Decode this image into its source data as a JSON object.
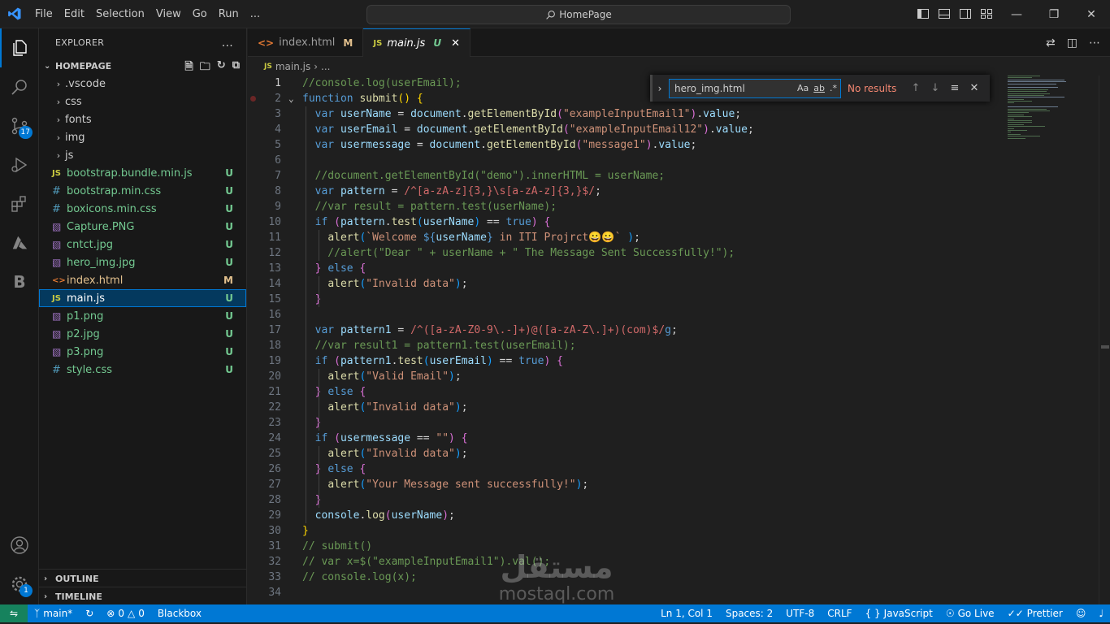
{
  "menu": [
    "File",
    "Edit",
    "Selection",
    "View",
    "Go",
    "Run",
    "..."
  ],
  "command_center": "HomePage",
  "explorer": {
    "title": "EXPLORER",
    "more": "...",
    "folder": "HOMEPAGE",
    "items": [
      {
        "label": ".vscode",
        "type": "folder",
        "status": ""
      },
      {
        "label": "css",
        "type": "folder",
        "status": ""
      },
      {
        "label": "fonts",
        "type": "folder",
        "status": ""
      },
      {
        "label": "img",
        "type": "folder",
        "status": ""
      },
      {
        "label": "js",
        "type": "folder",
        "status": ""
      },
      {
        "label": "bootstrap.bundle.min.js",
        "type": "js",
        "status": "U"
      },
      {
        "label": "bootstrap.min.css",
        "type": "css",
        "status": "U"
      },
      {
        "label": "boxicons.min.css",
        "type": "css",
        "status": "U"
      },
      {
        "label": "Capture.PNG",
        "type": "image",
        "status": "U"
      },
      {
        "label": "cntct.jpg",
        "type": "image",
        "status": "U"
      },
      {
        "label": "hero_img.jpg",
        "type": "image",
        "status": "U"
      },
      {
        "label": "index.html",
        "type": "html",
        "status": "M"
      },
      {
        "label": "main.js",
        "type": "js",
        "status": "U",
        "selected": true
      },
      {
        "label": "p1.png",
        "type": "image",
        "status": "U"
      },
      {
        "label": "p2.jpg",
        "type": "image",
        "status": "U"
      },
      {
        "label": "p3.png",
        "type": "image",
        "status": "U"
      },
      {
        "label": "style.css",
        "type": "css",
        "status": "U"
      }
    ],
    "outline": "OUTLINE",
    "timeline": "TIMELINE"
  },
  "activity": {
    "source_control_badge": "17",
    "accounts_badge": "1"
  },
  "tabs": [
    {
      "label": "index.html",
      "status": "M",
      "icon": "html-file-icon"
    },
    {
      "label": "main.js",
      "status": "U",
      "icon": "js-file-icon",
      "active": true
    }
  ],
  "breadcrumb": {
    "file": "main.js",
    "rest": "..."
  },
  "find": {
    "query": "hero_img.html",
    "match_case": "Aa",
    "whole_word": "ab",
    "regex": ".*",
    "result": "No results"
  },
  "editor": {
    "lines": [
      {
        "n": "1",
        "t": [
          [
            "//console.log(userEmail);",
            "cm"
          ]
        ]
      },
      {
        "n": "2",
        "t": [
          [
            "function",
            "kw"
          ],
          [
            " ",
            "pl"
          ],
          [
            "submit",
            "fn"
          ],
          [
            "() ",
            "b1"
          ],
          [
            "{",
            "b1"
          ]
        ]
      },
      {
        "n": "3",
        "t": [
          [
            "  ",
            "pl"
          ],
          [
            "var",
            "kw"
          ],
          [
            " ",
            "pl"
          ],
          [
            "userName",
            "vr"
          ],
          [
            " = ",
            "op"
          ],
          [
            "document",
            "vr"
          ],
          [
            ".",
            "op"
          ],
          [
            "getElementById",
            "fn"
          ],
          [
            "(",
            "b2"
          ],
          [
            "\"exampleInputEmail1\"",
            "st"
          ],
          [
            ")",
            "b2"
          ],
          [
            ".",
            "op"
          ],
          [
            "value",
            "vr"
          ],
          [
            ";",
            "op"
          ]
        ]
      },
      {
        "n": "4",
        "t": [
          [
            "  ",
            "pl"
          ],
          [
            "var",
            "kw"
          ],
          [
            " ",
            "pl"
          ],
          [
            "userEmail",
            "vr"
          ],
          [
            " = ",
            "op"
          ],
          [
            "document",
            "vr"
          ],
          [
            ".",
            "op"
          ],
          [
            "getElementById",
            "fn"
          ],
          [
            "(",
            "b2"
          ],
          [
            "\"exampleInputEmail12\"",
            "st"
          ],
          [
            ")",
            "b2"
          ],
          [
            ".",
            "op"
          ],
          [
            "value",
            "vr"
          ],
          [
            ";",
            "op"
          ]
        ]
      },
      {
        "n": "5",
        "t": [
          [
            "  ",
            "pl"
          ],
          [
            "var",
            "kw"
          ],
          [
            " ",
            "pl"
          ],
          [
            "usermessage",
            "vr"
          ],
          [
            " = ",
            "op"
          ],
          [
            "document",
            "vr"
          ],
          [
            ".",
            "op"
          ],
          [
            "getElementById",
            "fn"
          ],
          [
            "(",
            "b2"
          ],
          [
            "\"message1\"",
            "st"
          ],
          [
            ")",
            "b2"
          ],
          [
            ".",
            "op"
          ],
          [
            "value",
            "vr"
          ],
          [
            ";",
            "op"
          ]
        ]
      },
      {
        "n": "6",
        "t": []
      },
      {
        "n": "7",
        "t": [
          [
            "  //document.getElementById(\"demo\").innerHTML = userName;",
            "cm"
          ]
        ]
      },
      {
        "n": "8",
        "t": [
          [
            "  ",
            "pl"
          ],
          [
            "var",
            "kw"
          ],
          [
            " ",
            "pl"
          ],
          [
            "pattern",
            "vr"
          ],
          [
            " = ",
            "op"
          ],
          [
            "/^[a-zA-z]{3,}\\s[a-zA-z]{3,}$/",
            "rx"
          ],
          [
            ";",
            "op"
          ]
        ]
      },
      {
        "n": "9",
        "t": [
          [
            "  //var result = pattern.test(userName);",
            "cm"
          ]
        ]
      },
      {
        "n": "10",
        "t": [
          [
            "  ",
            "pl"
          ],
          [
            "if",
            "kw"
          ],
          [
            " ",
            "pl"
          ],
          [
            "(",
            "b2"
          ],
          [
            "pattern",
            "vr"
          ],
          [
            ".",
            "op"
          ],
          [
            "test",
            "fn"
          ],
          [
            "(",
            "b3"
          ],
          [
            "userName",
            "vr"
          ],
          [
            ")",
            "b3"
          ],
          [
            " == ",
            "op"
          ],
          [
            "true",
            "kw"
          ],
          [
            ")",
            "b2"
          ],
          [
            " ",
            "pl"
          ],
          [
            "{",
            "b2"
          ]
        ]
      },
      {
        "n": "11",
        "t": [
          [
            "    ",
            "pl"
          ],
          [
            "alert",
            "fn"
          ],
          [
            "(",
            "b3"
          ],
          [
            "`Welcome ",
            "st"
          ],
          [
            "${",
            "kw"
          ],
          [
            "userName",
            "vr"
          ],
          [
            "}",
            "kw"
          ],
          [
            " in ITI Projrct😀😀` ",
            "st"
          ],
          [
            ")",
            "b3"
          ],
          [
            ";",
            "op"
          ]
        ]
      },
      {
        "n": "12",
        "t": [
          [
            "    //alert(\"Dear \" + userName + \" The Message Sent Successfully!\");",
            "cm"
          ]
        ]
      },
      {
        "n": "13",
        "t": [
          [
            "  ",
            "pl"
          ],
          [
            "}",
            "b2"
          ],
          [
            " ",
            "pl"
          ],
          [
            "else",
            "kw"
          ],
          [
            " ",
            "pl"
          ],
          [
            "{",
            "b2"
          ]
        ]
      },
      {
        "n": "14",
        "t": [
          [
            "    ",
            "pl"
          ],
          [
            "alert",
            "fn"
          ],
          [
            "(",
            "b3"
          ],
          [
            "\"Invalid data\"",
            "st"
          ],
          [
            ")",
            "b3"
          ],
          [
            ";",
            "op"
          ]
        ]
      },
      {
        "n": "15",
        "t": [
          [
            "  ",
            "pl"
          ],
          [
            "}",
            "b2"
          ]
        ]
      },
      {
        "n": "16",
        "t": []
      },
      {
        "n": "17",
        "t": [
          [
            "  ",
            "pl"
          ],
          [
            "var",
            "kw"
          ],
          [
            " ",
            "pl"
          ],
          [
            "pattern1",
            "vr"
          ],
          [
            " = ",
            "op"
          ],
          [
            "/^([a-zA-Z0-9\\.-]+)@([a-zA-Z\\.]+)(com)$/",
            "rx"
          ],
          [
            "g",
            "kw"
          ],
          [
            ";",
            "op"
          ]
        ]
      },
      {
        "n": "18",
        "t": [
          [
            "  //var result1 = pattern1.test(userEmail);",
            "cm"
          ]
        ]
      },
      {
        "n": "19",
        "t": [
          [
            "  ",
            "pl"
          ],
          [
            "if",
            "kw"
          ],
          [
            " ",
            "pl"
          ],
          [
            "(",
            "b2"
          ],
          [
            "pattern1",
            "vr"
          ],
          [
            ".",
            "op"
          ],
          [
            "test",
            "fn"
          ],
          [
            "(",
            "b3"
          ],
          [
            "userEmail",
            "vr"
          ],
          [
            ")",
            "b3"
          ],
          [
            " == ",
            "op"
          ],
          [
            "true",
            "kw"
          ],
          [
            ")",
            "b2"
          ],
          [
            " ",
            "pl"
          ],
          [
            "{",
            "b2"
          ]
        ]
      },
      {
        "n": "20",
        "t": [
          [
            "    ",
            "pl"
          ],
          [
            "alert",
            "fn"
          ],
          [
            "(",
            "b3"
          ],
          [
            "\"Valid Email\"",
            "st"
          ],
          [
            ")",
            "b3"
          ],
          [
            ";",
            "op"
          ]
        ]
      },
      {
        "n": "21",
        "t": [
          [
            "  ",
            "pl"
          ],
          [
            "}",
            "b2"
          ],
          [
            " ",
            "pl"
          ],
          [
            "else",
            "kw"
          ],
          [
            " ",
            "pl"
          ],
          [
            "{",
            "b2"
          ]
        ]
      },
      {
        "n": "22",
        "t": [
          [
            "    ",
            "pl"
          ],
          [
            "alert",
            "fn"
          ],
          [
            "(",
            "b3"
          ],
          [
            "\"Invalid data\"",
            "st"
          ],
          [
            ")",
            "b3"
          ],
          [
            ";",
            "op"
          ]
        ]
      },
      {
        "n": "23",
        "t": [
          [
            "  ",
            "pl"
          ],
          [
            "}",
            "b2"
          ]
        ]
      },
      {
        "n": "24",
        "t": [
          [
            "  ",
            "pl"
          ],
          [
            "if",
            "kw"
          ],
          [
            " ",
            "pl"
          ],
          [
            "(",
            "b2"
          ],
          [
            "usermessage",
            "vr"
          ],
          [
            " == ",
            "op"
          ],
          [
            "\"\"",
            "st"
          ],
          [
            ")",
            "b2"
          ],
          [
            " ",
            "pl"
          ],
          [
            "{",
            "b2"
          ]
        ]
      },
      {
        "n": "25",
        "t": [
          [
            "    ",
            "pl"
          ],
          [
            "alert",
            "fn"
          ],
          [
            "(",
            "b3"
          ],
          [
            "\"Invalid data\"",
            "st"
          ],
          [
            ")",
            "b3"
          ],
          [
            ";",
            "op"
          ]
        ]
      },
      {
        "n": "26",
        "t": [
          [
            "  ",
            "pl"
          ],
          [
            "}",
            "b2"
          ],
          [
            " ",
            "pl"
          ],
          [
            "else",
            "kw"
          ],
          [
            " ",
            "pl"
          ],
          [
            "{",
            "b2"
          ]
        ]
      },
      {
        "n": "27",
        "t": [
          [
            "    ",
            "pl"
          ],
          [
            "alert",
            "fn"
          ],
          [
            "(",
            "b3"
          ],
          [
            "\"Your Message sent successfully!\"",
            "st"
          ],
          [
            ")",
            "b3"
          ],
          [
            ";",
            "op"
          ]
        ]
      },
      {
        "n": "28",
        "t": [
          [
            "  ",
            "pl"
          ],
          [
            "}",
            "b2"
          ]
        ]
      },
      {
        "n": "29",
        "t": [
          [
            "  ",
            "pl"
          ],
          [
            "console",
            "vr"
          ],
          [
            ".",
            "op"
          ],
          [
            "log",
            "fn"
          ],
          [
            "(",
            "b2"
          ],
          [
            "userName",
            "vr"
          ],
          [
            ")",
            "b2"
          ],
          [
            ";",
            "op"
          ]
        ]
      },
      {
        "n": "30",
        "t": [
          [
            "}",
            "b1"
          ]
        ]
      },
      {
        "n": "31",
        "t": [
          [
            "// submit()",
            "cm"
          ]
        ]
      },
      {
        "n": "32",
        "t": [
          [
            "// var x=$(\"exampleInputEmail1\").val();",
            "cm"
          ]
        ]
      },
      {
        "n": "33",
        "t": [
          [
            "// console.log(x);",
            "cm"
          ]
        ]
      },
      {
        "n": "34",
        "t": []
      }
    ]
  },
  "watermark": {
    "arabic": "مستقل",
    "latin": "mostaql.com"
  },
  "statusbar": {
    "branch": "main*",
    "errors": "0",
    "warnings": "0",
    "blackbox": "Blackbox",
    "position": "Ln 1, Col 1",
    "spaces": "Spaces: 2",
    "encoding": "UTF-8",
    "eol": "CRLF",
    "language": "JavaScript",
    "golive": "Go Live",
    "prettier": "Prettier"
  }
}
